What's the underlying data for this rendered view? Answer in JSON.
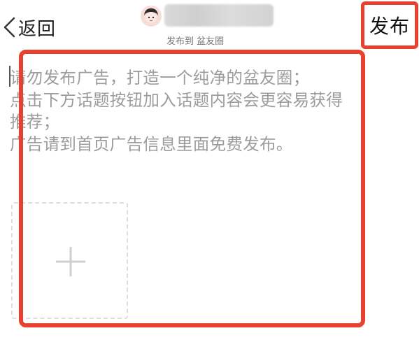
{
  "header": {
    "back_label": "返回",
    "publish_to": "发布到 盆友圈",
    "publish_label": "发布"
  },
  "editor": {
    "placeholder_lines": [
      "请勿发布广告，打造一个纯净的盆友圈；",
      "点击下方话题按钮加入话题内容会更容易获得",
      "推荐；",
      "广告请到首页广告信息里面免费发布。"
    ]
  },
  "colors": {
    "highlight": "#e8412f",
    "placeholder_text": "#9c9c9c",
    "dashed_border": "#dedede"
  },
  "icons": {
    "back": "chevron-left-icon",
    "add_image": "plus-icon"
  }
}
